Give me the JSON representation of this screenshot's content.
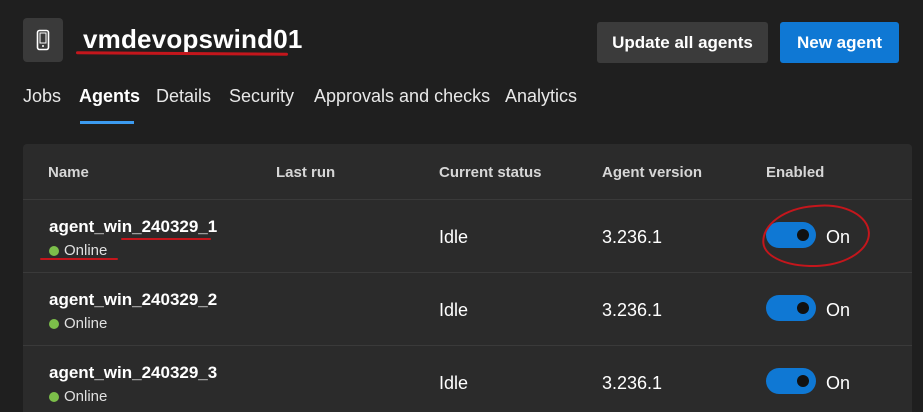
{
  "header": {
    "icon": "device-phone-icon",
    "title": "vmdevopswind01",
    "update_all_label": "Update all agents",
    "new_agent_label": "New agent"
  },
  "tabs": [
    {
      "label": "Jobs",
      "active": false
    },
    {
      "label": "Agents",
      "active": true
    },
    {
      "label": "Details",
      "active": false
    },
    {
      "label": "Security",
      "active": false
    },
    {
      "label": "Approvals and checks",
      "active": false
    },
    {
      "label": "Analytics",
      "active": false
    }
  ],
  "table": {
    "columns": [
      "Name",
      "Last run",
      "Current status",
      "Agent version",
      "Enabled"
    ],
    "rows": [
      {
        "name": "agent_win_240329_1",
        "state": "Online",
        "last_run": "",
        "status": "Idle",
        "version": "3.236.1",
        "enabled": true,
        "enabled_label": "On"
      },
      {
        "name": "agent_win_240329_2",
        "state": "Online",
        "last_run": "",
        "status": "Idle",
        "version": "3.236.1",
        "enabled": true,
        "enabled_label": "On"
      },
      {
        "name": "agent_win_240329_3",
        "state": "Online",
        "last_run": "",
        "status": "Idle",
        "version": "3.236.1",
        "enabled": true,
        "enabled_label": "On"
      }
    ]
  },
  "colors": {
    "primary": "#0f78d4",
    "online": "#7cbf4a",
    "annotation": "#c4161c",
    "background": "#1f1f1f",
    "card": "#2b2b2b"
  }
}
